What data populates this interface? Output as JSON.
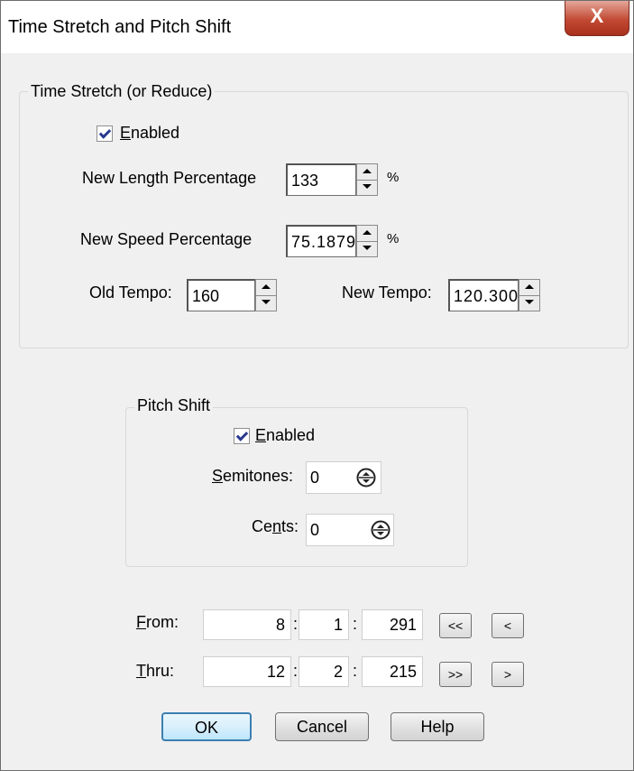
{
  "window": {
    "title": "Time Stretch and Pitch Shift",
    "close_label": "X"
  },
  "time_stretch": {
    "group_label": "Time Stretch (or Reduce)",
    "enabled_label": "Enabled",
    "enabled_mnemonic": "E",
    "enabled_rest": "nabled",
    "enabled_checked": true,
    "new_length_label": "New Length Percentage",
    "new_length_value": "133",
    "new_length_unit": "%",
    "new_speed_label": "New Speed Percentage",
    "new_speed_value": "75.1879",
    "new_speed_unit": "%",
    "old_tempo_label": "Old Tempo:",
    "old_tempo_value": "160",
    "new_tempo_label": "New Tempo:",
    "new_tempo_value": "120.300"
  },
  "pitch_shift": {
    "group_label": "Pitch Shift",
    "enabled_mnemonic": "E",
    "enabled_rest": "nabled",
    "enabled_checked": true,
    "semitones_mnemonic": "S",
    "semitones_rest": "emitones:",
    "semitones_value": "0",
    "cents_pre": "Ce",
    "cents_mnemonic": "n",
    "cents_rest": "ts:",
    "cents_value": "0"
  },
  "range": {
    "from_mnemonic": "F",
    "from_rest": "rom:",
    "from_values": [
      "8",
      "1",
      "291"
    ],
    "thru_mnemonic": "T",
    "thru_rest": "hru:",
    "thru_values": [
      "12",
      "2",
      "215"
    ],
    "separator": ":",
    "rewind_label": "<<",
    "back_label": "<",
    "forward_end_label": ">>",
    "forward_label": ">"
  },
  "buttons": {
    "ok": "OK",
    "cancel": "Cancel",
    "help": "Help"
  },
  "colors": {
    "close_red": "#c24a34",
    "check_blue": "#2a3a8f",
    "default_button_border": "#3c7fb1"
  }
}
